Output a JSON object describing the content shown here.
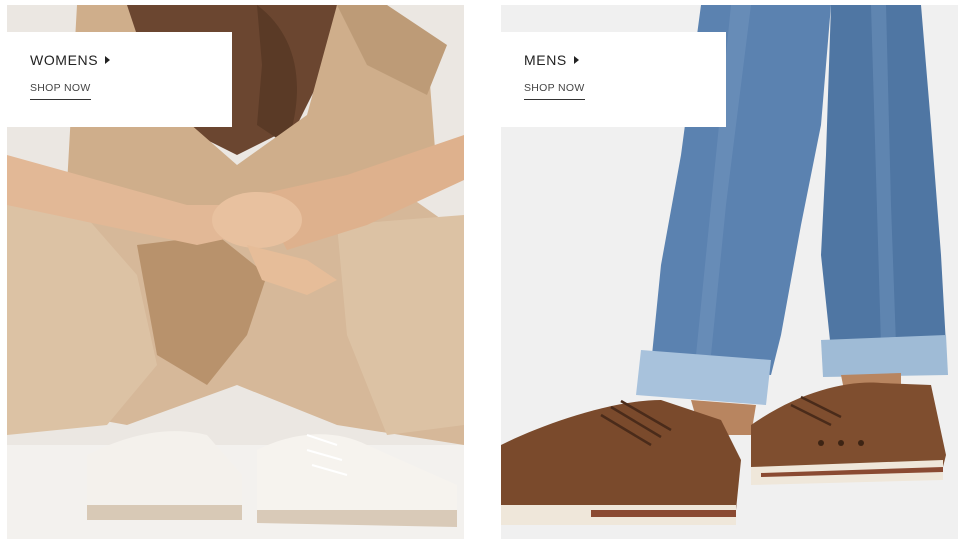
{
  "tiles": {
    "women": {
      "title": "WOMENS",
      "cta": "SHOP NOW",
      "image": "woman-beige-jumpsuit-white-sneakers-photo",
      "arrow_icon": "caret-right-icon"
    },
    "men": {
      "title": "MENS",
      "cta": "SHOP NOW",
      "image": "man-blue-jeans-brown-leather-sneakers-photo",
      "arrow_icon": "caret-right-icon"
    }
  },
  "colors": {
    "background": "#ffffff",
    "card": "#ffffff",
    "text": "#222222",
    "women_photo_bg": "#efece8",
    "men_photo_bg": "#f1f1f1",
    "denim": "#5a7fab",
    "leather": "#7a4a2c",
    "beige": "#d2b394"
  }
}
